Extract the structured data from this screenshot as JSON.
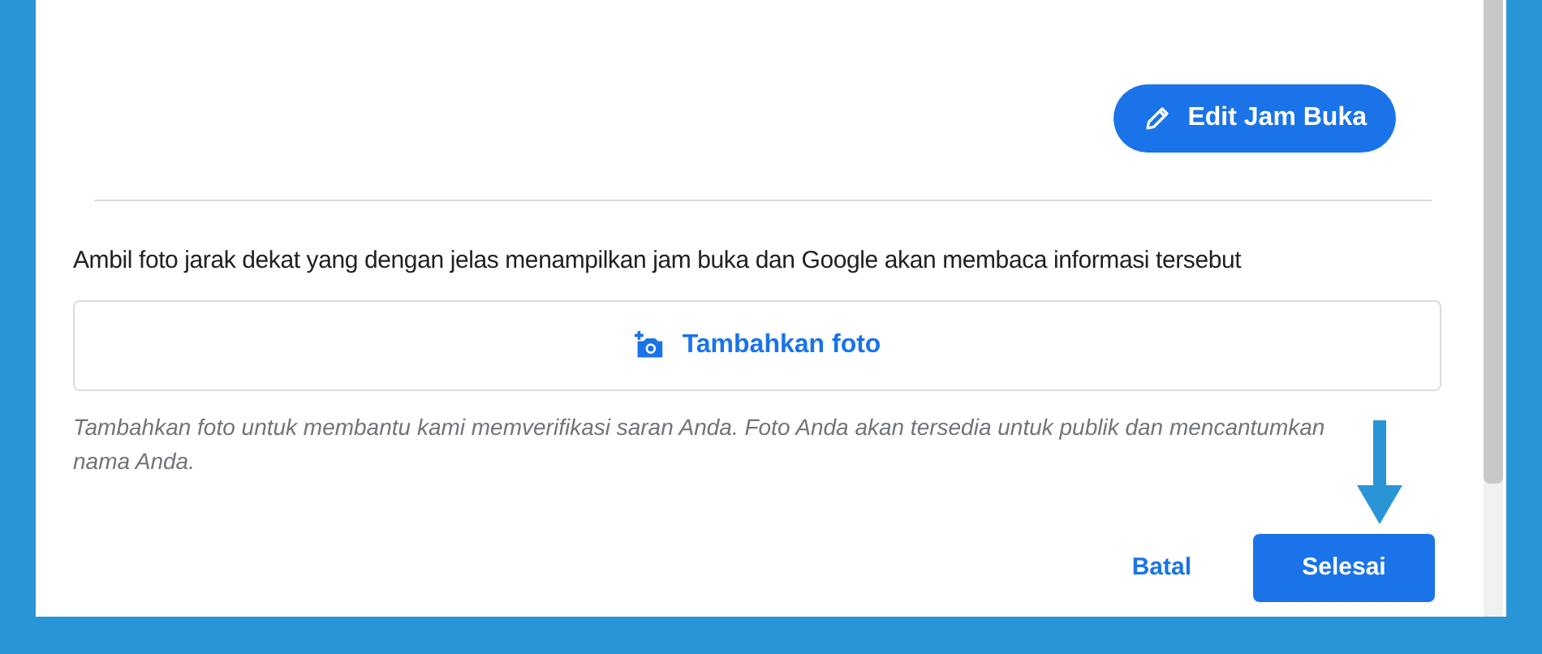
{
  "edit_button": {
    "label": "Edit Jam Buka"
  },
  "instruction": "Ambil foto jarak dekat yang dengan jelas menampilkan jam buka dan Google akan membaca informasi tersebut",
  "add_photo": {
    "label": "Tambahkan foto"
  },
  "note": "Tambahkan foto untuk membantu kami memverifikasi saran Anda. Foto Anda akan tersedia untuk publik dan mencantumkan nama Anda.",
  "buttons": [
    {
      "label": "Batal",
      "kind": "text"
    },
    {
      "label": "Selesai",
      "kind": "primary"
    }
  ]
}
